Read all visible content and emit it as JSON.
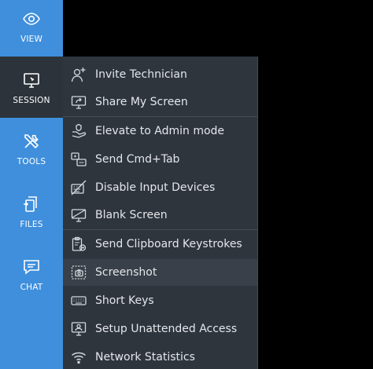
{
  "toolbar": {
    "items": [
      {
        "label": "VIEW",
        "icon": "eye-icon",
        "active": false
      },
      {
        "label": "SESSION",
        "icon": "monitor-icon",
        "active": true
      },
      {
        "label": "TOOLS",
        "icon": "tools-icon",
        "active": false
      },
      {
        "label": "FILES",
        "icon": "files-icon",
        "active": false
      },
      {
        "label": "CHAT",
        "icon": "chat-icon",
        "active": false
      }
    ]
  },
  "menu": {
    "items": [
      {
        "label": "Invite Technician",
        "icon": "add-user-icon"
      },
      {
        "label": "Share My Screen",
        "icon": "share-screen-icon"
      },
      {
        "label": "Elevate to Admin mode",
        "icon": "admin-icon"
      },
      {
        "label": "Send Cmd+Tab",
        "icon": "cmd-tab-icon"
      },
      {
        "label": "Disable Input Devices",
        "icon": "disable-input-icon"
      },
      {
        "label": "Blank Screen",
        "icon": "blank-screen-icon"
      },
      {
        "label": "Send Clipboard Keystrokes",
        "icon": "clipboard-icon"
      },
      {
        "label": "Screenshot",
        "icon": "screenshot-icon",
        "highlighted": true
      },
      {
        "label": "Short Keys",
        "icon": "keyboard-icon"
      },
      {
        "label": "Setup Unattended Access",
        "icon": "unattended-access-icon"
      },
      {
        "label": "Network Statistics",
        "icon": "wifi-icon"
      }
    ]
  },
  "colors": {
    "toolbar_bg": "#3f8fdc",
    "toolbar_active_bg": "#2d333b",
    "menu_bg": "#2f353d",
    "menu_highlight_bg": "#3a4049",
    "menu_text": "#e4e7eb"
  }
}
